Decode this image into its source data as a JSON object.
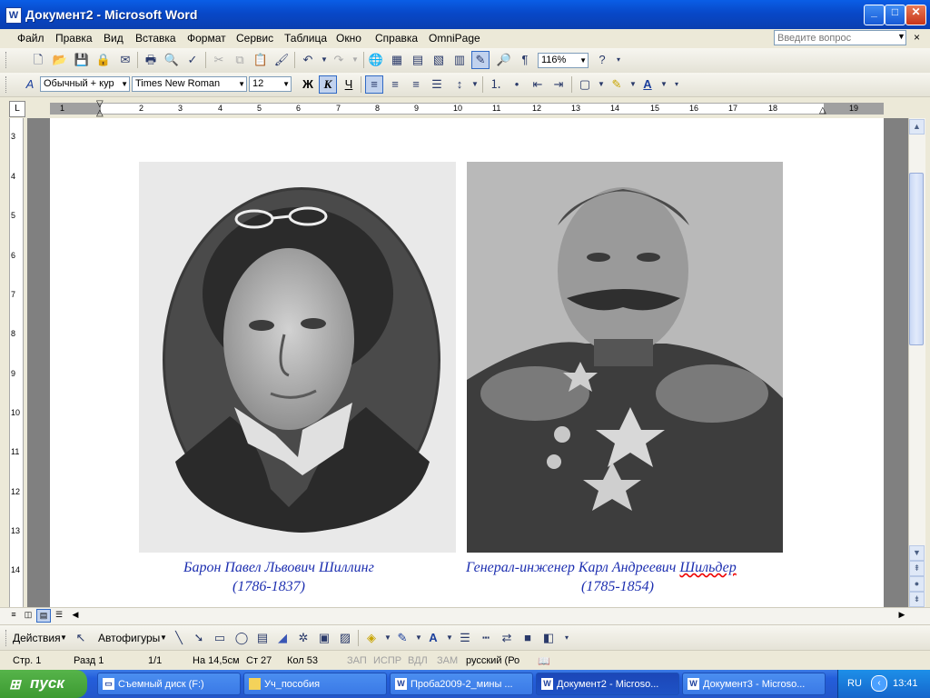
{
  "window": {
    "title": "Документ2 - Microsoft Word",
    "app_icon": "W",
    "minimize_icon": "_",
    "maximize_icon": "□",
    "close_icon": "✕"
  },
  "menu": {
    "items": [
      "Файл",
      "Правка",
      "Вид",
      "Вставка",
      "Формат",
      "Сервис",
      "Таблица",
      "Окно",
      "Справка",
      "OmniPage"
    ],
    "help_placeholder": "Введите вопрос",
    "close_icon": "×"
  },
  "toolbar_standard": {
    "zoom": "116%"
  },
  "toolbar_formatting": {
    "style": "Обычный + кур",
    "font": "Times New Roman",
    "size": "12",
    "bold": "Ж",
    "italic": "К",
    "underline": "Ч"
  },
  "ruler": {
    "numbers": [
      "1",
      "2",
      "3",
      "4",
      "5",
      "6",
      "7",
      "8",
      "9",
      "10",
      "11",
      "12",
      "13",
      "14",
      "15",
      "16",
      "17",
      "18",
      "19"
    ],
    "vertical_numbers": [
      "3",
      "4",
      "5",
      "6",
      "7",
      "8",
      "9",
      "10",
      "11",
      "12",
      "13",
      "14"
    ],
    "tab_icon": "L"
  },
  "document": {
    "portraits": [
      {
        "name": "Барон Павел  Львович Шиллинг",
        "years": "(1786-1837)"
      },
      {
        "name_prefix": "Генерал-инженер  Карл  Андреевич ",
        "name_misspelled": "Шильдер",
        "years": "(1785-1854)"
      }
    ]
  },
  "drawing_toolbar": {
    "actions": "Действия",
    "autoshapes": "Автофигуры"
  },
  "status": {
    "page": "Стр.  1",
    "section": "Разд  1",
    "pages": "1/1",
    "at": "На 14,5см",
    "line": "Ст  27",
    "col": "Кол  53",
    "rec": "ЗАП",
    "trk": "ИСПР",
    "ext": "ВДЛ",
    "ovr": "ЗАМ",
    "language": "русский (Ро"
  },
  "taskbar": {
    "start": "пуск",
    "tasks": [
      "Съемный диск (F:)",
      "Уч_пособия",
      "Проба2009-2_мины ...",
      "Документ2 - Microso...",
      "Документ3 - Microso..."
    ],
    "lang": "RU",
    "time": "13:41"
  },
  "colors": {
    "caption_text": "#1d2fb0",
    "titlebar": "#0a5ee6",
    "taskbar": "#245edb"
  }
}
